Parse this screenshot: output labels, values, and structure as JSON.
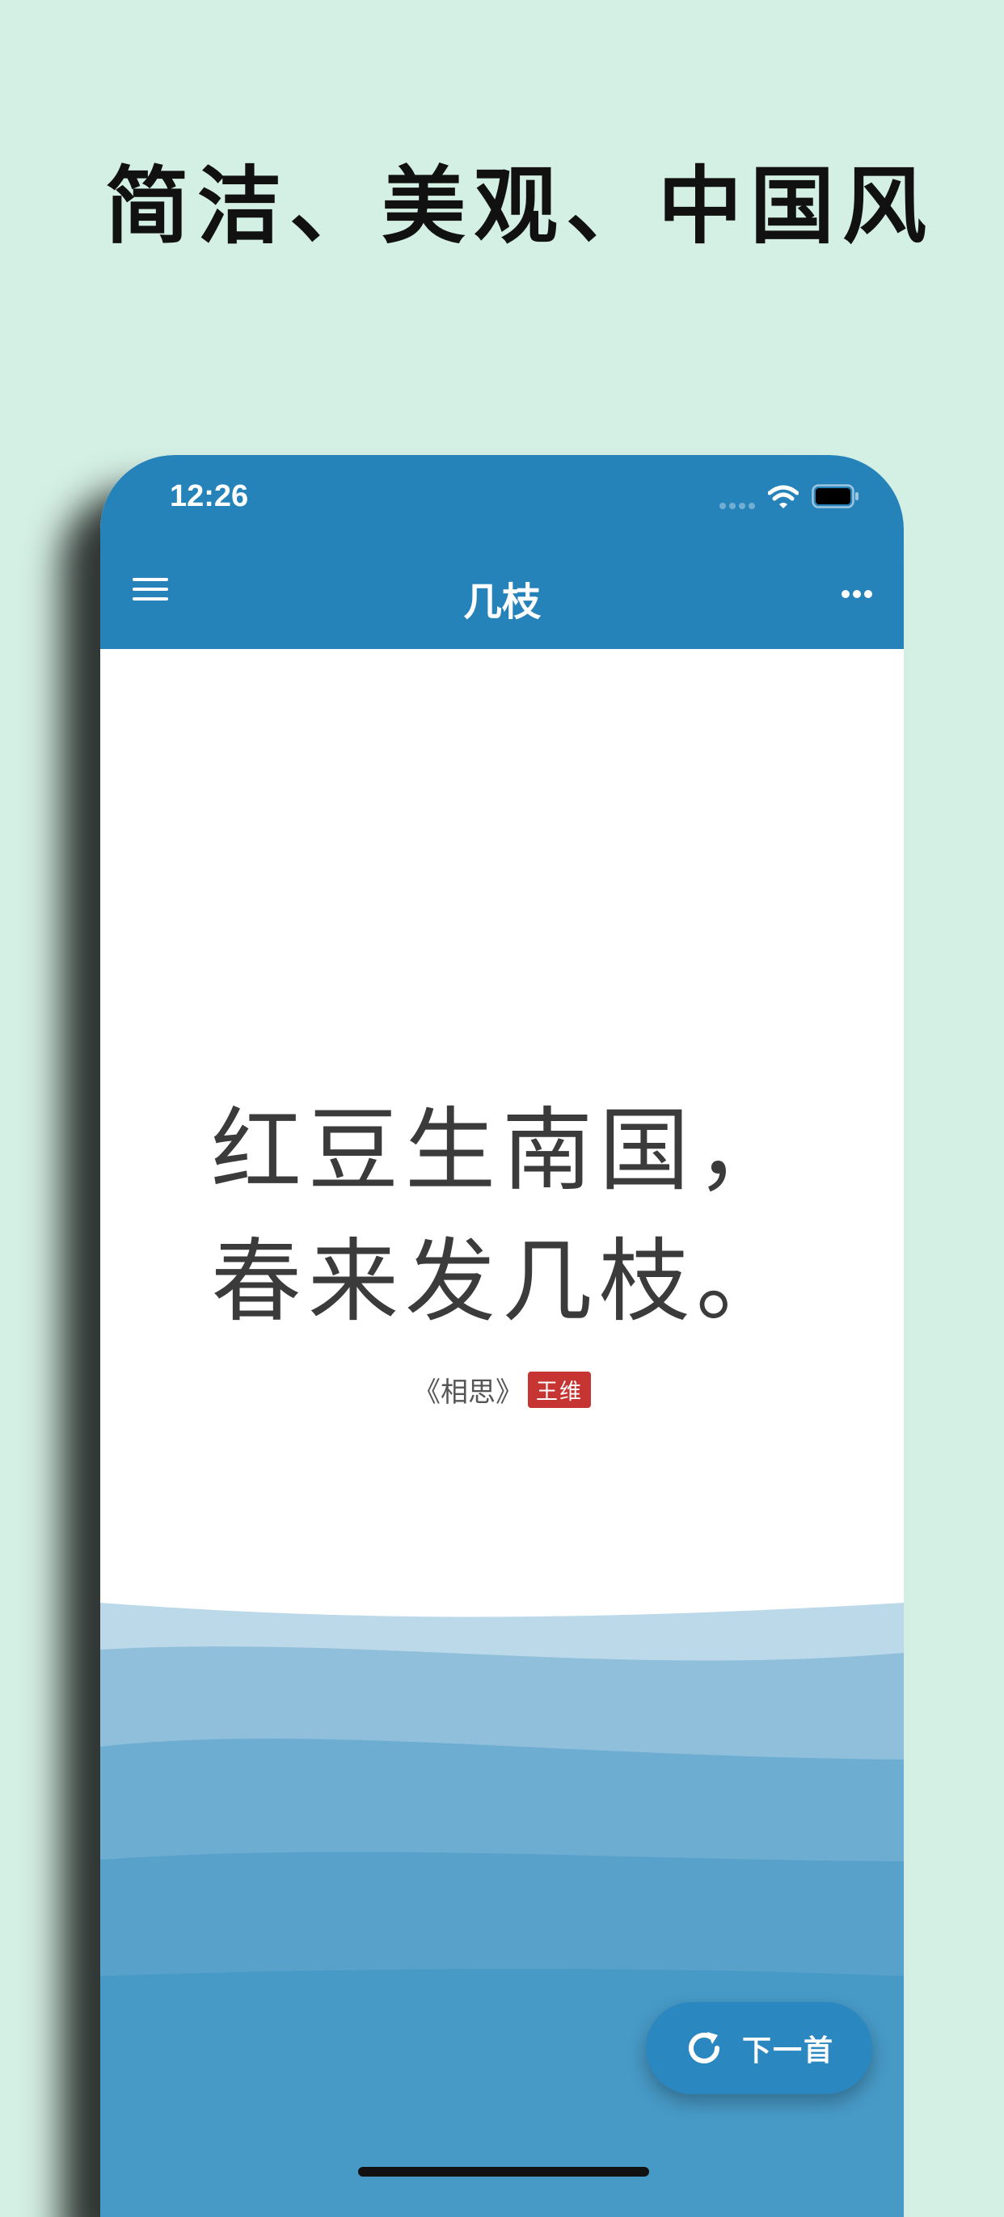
{
  "headline": "简洁、美观、中国风",
  "status_bar": {
    "time": "12:26",
    "signal_icon": "cellular-signal-icon",
    "wifi_icon": "wifi-icon",
    "battery_icon": "battery-icon"
  },
  "app_bar": {
    "title": "几枝",
    "menu_icon": "hamburger-menu-icon",
    "more_icon": "more-dots-icon"
  },
  "poem": {
    "line1": "红豆生南国，",
    "line2": "春来发几枝。",
    "source_title": "《相思》",
    "author": "王维"
  },
  "next_button": {
    "label": "下一首",
    "icon": "refresh-icon"
  },
  "colors": {
    "background": "#d4efe4",
    "app_bar": "#2683ba",
    "author_badge": "#c63532",
    "wave_layers": [
      "#bcd9ea",
      "#8fbfda",
      "#6dadd1",
      "#57a1cb",
      "#4799c6"
    ]
  }
}
